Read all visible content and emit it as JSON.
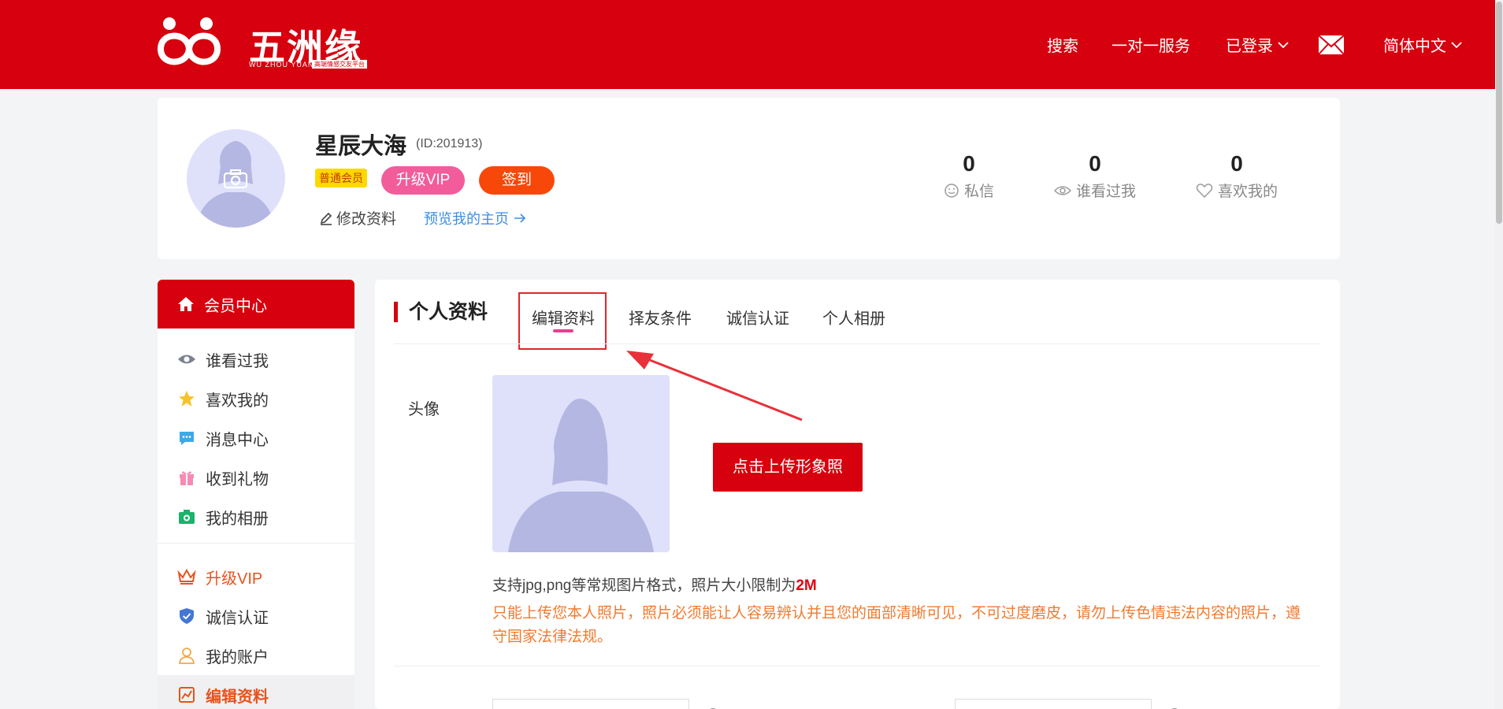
{
  "brand": {
    "name": "五洲缘",
    "pinyin": "WU ZHOU YUAN",
    "slogan": "高端情感交友平台"
  },
  "nav": {
    "search": "搜索",
    "service": "一对一服务",
    "login": "已登录",
    "language": "简体中文"
  },
  "profile": {
    "nickname": "星辰大海",
    "uid": "(ID:201913)",
    "member_badge": "普通会员",
    "vip_button": "升级VIP",
    "sign_button": "签到",
    "edit_link": "修改资料",
    "preview_link": "预览我的主页"
  },
  "stats": [
    {
      "value": "0",
      "label": "私信"
    },
    {
      "value": "0",
      "label": "谁看过我"
    },
    {
      "value": "0",
      "label": "喜欢我的"
    }
  ],
  "sidebar": {
    "header": "会员中心",
    "items": [
      {
        "label": "谁看过我"
      },
      {
        "label": "喜欢我的"
      },
      {
        "label": "消息中心"
      },
      {
        "label": "收到礼物"
      },
      {
        "label": "我的相册"
      },
      {
        "label": "升级VIP"
      },
      {
        "label": "诚信认证"
      },
      {
        "label": "我的账户"
      },
      {
        "label": "编辑资料"
      }
    ]
  },
  "main": {
    "section_title": "个人资料",
    "tabs": [
      {
        "label": "编辑资料"
      },
      {
        "label": "择友条件"
      },
      {
        "label": "诚信认证"
      },
      {
        "label": "个人相册"
      }
    ],
    "avatar_label": "头像",
    "upload_button": "点击上传形象照",
    "hint_prefix": "支持jpg,png等常规图片格式，照片大小限制为",
    "hint_size": "2M",
    "warning": "只能上传您本人照片，照片必须能让人容易辨认并且您的面部清晰可见，不可过度磨皮，请勿上传色情违法内容的照片，遵守国家法律法规。"
  },
  "colors": {
    "brand_red": "#d6000e",
    "vip_pink": "#f35c9a",
    "sign_orange": "#f7480a",
    "link_blue": "#3a8ee6",
    "warning_orange": "#f27a2e"
  }
}
